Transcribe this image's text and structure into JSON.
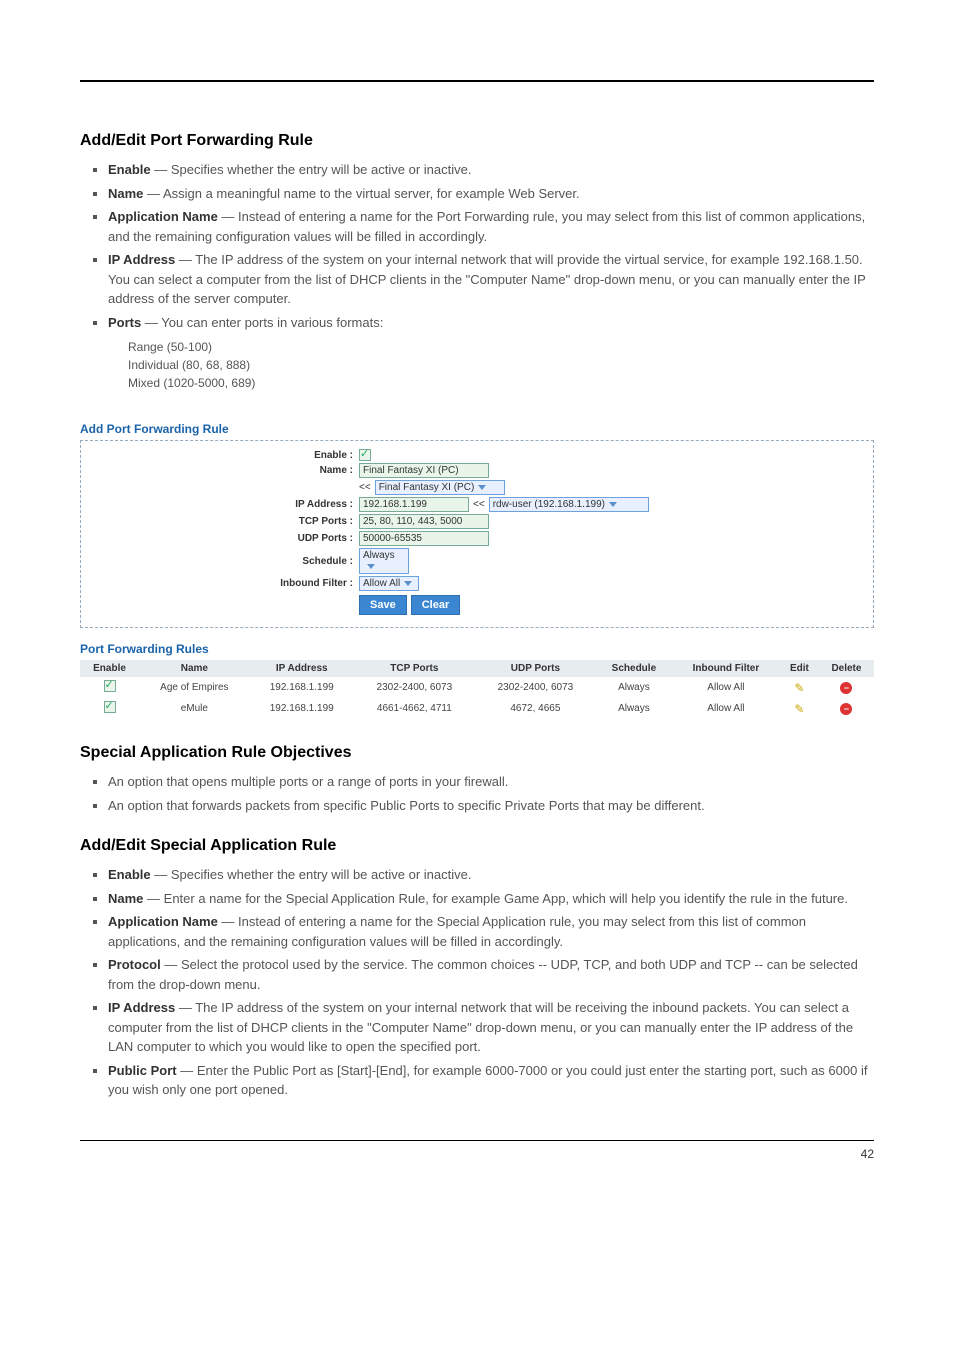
{
  "sec1": {
    "title": "Add/Edit Port Forwarding Rule",
    "items": [
      {
        "k": "Enable",
        "v": "Specifies whether the entry will be active or inactive."
      },
      {
        "k": "Name",
        "v": "Assign a meaningful name to the virtual server, for example Web Server."
      },
      {
        "k": "Application Name",
        "v": "Instead of entering a name for the Port Forwarding rule, you may select from this list of common applications, and the remaining configuration values will be filled in accordingly."
      },
      {
        "k": "IP Address",
        "v": "The IP address of the system on your internal network that will provide the virtual service, for example 192.168.1.50. You can select a computer from the list of DHCP clients in the \"Computer Name\" drop-down menu, or you can manually enter the IP address of the server computer."
      },
      {
        "k": "Ports",
        "v": "You can enter ports in various formats:"
      }
    ],
    "sub": [
      "Range (50-100)",
      "Individual (80, 68, 888)",
      "Mixed (1020-5000, 689)"
    ]
  },
  "add_form": {
    "title": "Add Port Forwarding Rule",
    "labels": {
      "enable": "Enable :",
      "name": "Name :",
      "ip": "IP Address :",
      "tcp": "TCP Ports :",
      "udp": "UDP Ports :",
      "sched": "Schedule :",
      "inf": "Inbound Filter :"
    },
    "name_value": "Final Fantasy XI (PC)",
    "preset_label": "<<",
    "preset_value": "Final Fantasy XI (PC)",
    "ip_value": "192.168.1.199",
    "ip_preset": "<<",
    "ip_preset_value": "rdw-user (192.168.1.199)",
    "tcp_value": "25, 80, 110, 443, 5000",
    "udp_value": "50000-65535",
    "sched_value": "Always",
    "inf_value": "Allow All",
    "save": "Save",
    "clear": "Clear"
  },
  "rules_table": {
    "title": "Port Forwarding Rules",
    "headers": [
      "Enable",
      "Name",
      "IP Address",
      "TCP Ports",
      "UDP Ports",
      "Schedule",
      "Inbound Filter",
      "Edit",
      "Delete"
    ],
    "rows": [
      {
        "en": true,
        "name": "Age of Empires",
        "ip": "192.168.1.199",
        "tcp": "2302-2400, 6073",
        "udp": "2302-2400, 6073",
        "sched": "Always",
        "inf": "Allow All"
      },
      {
        "en": true,
        "name": "eMule",
        "ip": "192.168.1.199",
        "tcp": "4661-4662, 4711",
        "udp": "4672, 4665",
        "sched": "Always",
        "inf": "Allow All"
      }
    ]
  },
  "special_apps": {
    "objective_title": "Special Application Rule Objectives",
    "obj_items": [
      "An option that opens multiple ports or a range of ports in your firewall.",
      "An option that forwards packets from specific Public Ports to specific Private Ports that may be different."
    ],
    "title": "Add/Edit Special Application Rule",
    "items": [
      {
        "k": "Enable",
        "v": "Specifies whether the entry will be active or inactive."
      },
      {
        "k": "Name",
        "v": "Enter a name for the Special Application Rule, for example Game App, which will help you identify the rule in the future."
      },
      {
        "k": "Application Name",
        "v": "Instead of entering a name for the Special Application rule, you may select from this list of common applications, and the remaining configuration values will be filled in accordingly."
      },
      {
        "k": "Protocol",
        "v": "Select the protocol used by the service. The common choices -- UDP, TCP, and both UDP and TCP -- can be selected from the drop-down menu."
      },
      {
        "k": "IP Address",
        "v": "The IP address of the system on your internal network that will be receiving the inbound packets. You can select a computer from the list of DHCP clients in the \"Computer Name\" drop-down menu, or you can manually enter the IP address of the LAN computer to which you would like to open the specified port."
      },
      {
        "k": "Public Port",
        "v": "Enter the Public Port as [Start]-[End], for example 6000-7000 or you could just enter the starting port, such as 6000 if you wish only one port opened."
      }
    ]
  },
  "page_number": "42"
}
